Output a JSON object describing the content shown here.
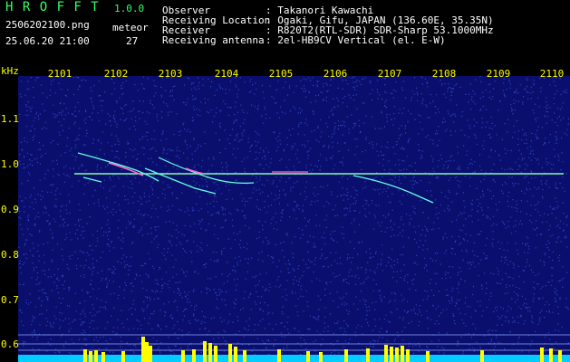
{
  "header": {
    "app_name": "H R O F F T",
    "version": "1.0.0",
    "filename": "2506202100.png",
    "datetime": "25.06.20 21:00",
    "counter_label": "meteor",
    "counter_value": "27",
    "info": [
      {
        "label": "Observer",
        "value": ": Takanori Kawachi"
      },
      {
        "label": "Receiving Location",
        "value": ": Ogaki, Gifu, JAPAN (136.60E, 35.35N)"
      },
      {
        "label": "Receiver",
        "value": ": R820T2(RTL-SDR) SDR-Sharp 53.1000MHz"
      },
      {
        "label": "Receiving antenna",
        "value": ": 2el-HB9CV Vertical (el. E-W)"
      }
    ]
  },
  "spectrogram": {
    "unit_label": "kHz",
    "x_ticks": [
      "2101",
      "2102",
      "2103",
      "2104",
      "2105",
      "2106",
      "2107",
      "2108",
      "2109",
      "2110"
    ],
    "y_ticks": [
      "1.1",
      "1.0",
      "0.9",
      "0.8",
      "0.7",
      "0.6"
    ],
    "colors": {
      "background": "#0a0f6e",
      "noise": "#3a55d8",
      "carrier": "#7fffb0",
      "echo": "#66ffdd",
      "echo_hot": "#ff66cc",
      "bars": "#ffff00",
      "baseline": "#00ccff",
      "labels": "#ffff00"
    }
  }
}
